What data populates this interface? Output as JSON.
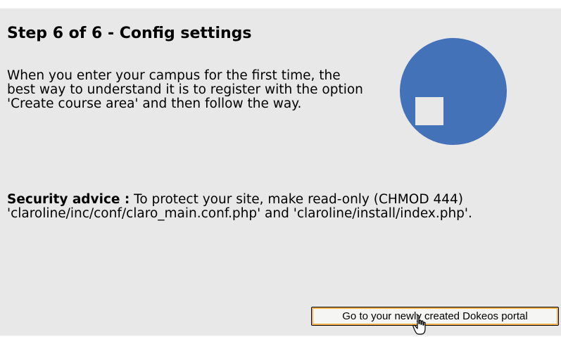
{
  "page": {
    "title": "Step 6 of 6 - Config settings",
    "intro": "When you enter your campus for the first time, the best way to understand it is to register with the option 'Create course area' and then follow the way.",
    "security": {
      "label": "Security advice :",
      "text": " To protect your site, make read-only (CHMOD 444) 'claroline/inc/conf/claro_main.conf.php' and 'claroline/install/index.php'."
    },
    "button_label": "Go to your newly created Dokeos portal"
  },
  "colors": {
    "panel_background": "#e8e8e8",
    "logo_circle": "#4472b8",
    "logo_square": "#e8e8e8",
    "button_focus_ring": "#f2b14a"
  },
  "icons": {
    "logo": "dokeos-logo-icon",
    "cursor": "hand-pointer-icon"
  }
}
